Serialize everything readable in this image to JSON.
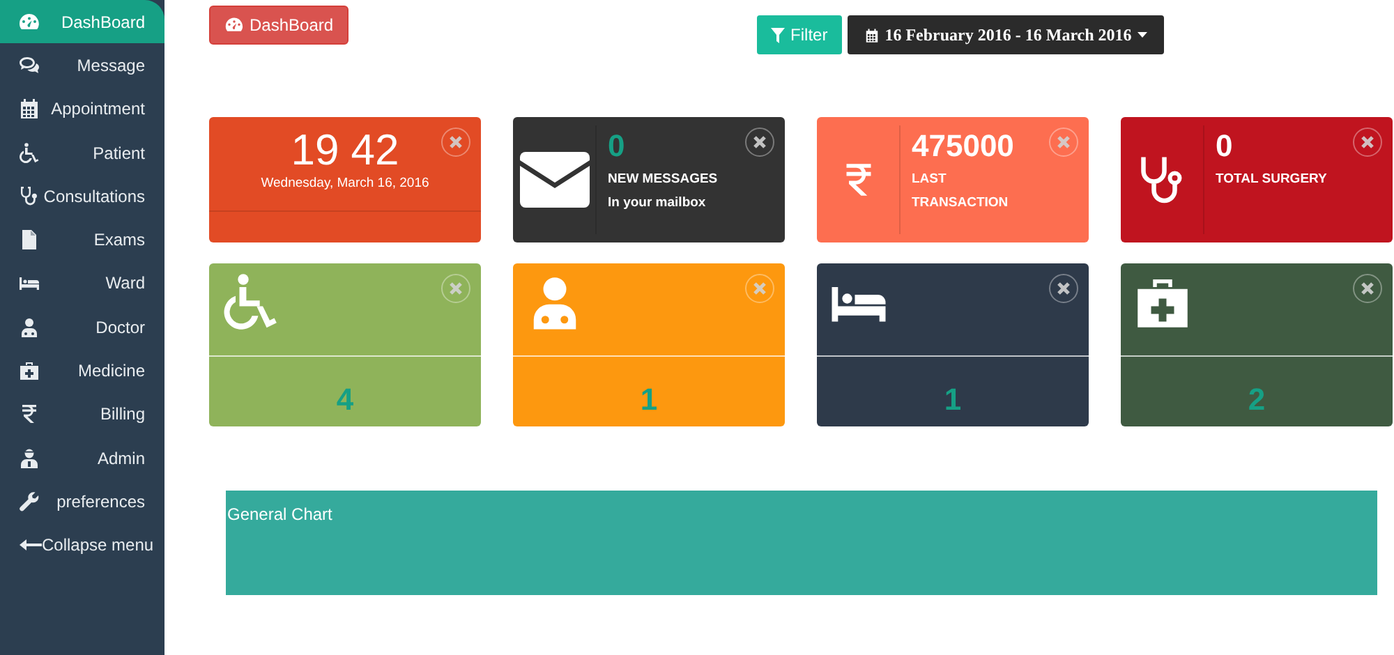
{
  "sidebar": {
    "items": [
      {
        "label": "DashBoard",
        "selected": true
      },
      {
        "label": "Message",
        "selected": false
      },
      {
        "label": "Appointment",
        "selected": false
      },
      {
        "label": "Patient",
        "selected": false
      },
      {
        "label": "Consultations",
        "selected": false
      },
      {
        "label": "Exams",
        "selected": false
      },
      {
        "label": "Ward",
        "selected": false
      },
      {
        "label": "Doctor",
        "selected": false
      },
      {
        "label": "Medicine",
        "selected": false
      },
      {
        "label": "Billing",
        "selected": false
      },
      {
        "label": "Admin",
        "selected": false
      },
      {
        "label": "preferences",
        "selected": false
      }
    ],
    "collapse": "Collapse menu"
  },
  "header": {
    "dashboard_button": "DashBoard",
    "filter_button": "Filter",
    "date_range": "16 February 2016 - 16 March 2016"
  },
  "summary_cards": [
    {
      "kind": "clock",
      "color": "#e24b25",
      "time": "19 42",
      "date": "Wednesday, March 16, 2016"
    },
    {
      "kind": "stat",
      "color": "#333333",
      "value": "0",
      "label": "NEW MESSAGES",
      "sublabel": "In your mailbox"
    },
    {
      "kind": "stat",
      "color": "#fd6e50",
      "value": "475000",
      "label": "LAST\nTRANSACTION"
    },
    {
      "kind": "stat",
      "color": "#c0141f",
      "value": "0",
      "label": "TOTAL SURGERY"
    }
  ],
  "count_cards": [
    {
      "color": "#8fb35a",
      "value": "4"
    },
    {
      "color": "#fd980f",
      "value": "1"
    },
    {
      "color": "#2e3a4a",
      "value": "1"
    },
    {
      "color": "#3f5a41",
      "value": "2"
    }
  ],
  "chart_panel": {
    "title": "General Chart"
  }
}
